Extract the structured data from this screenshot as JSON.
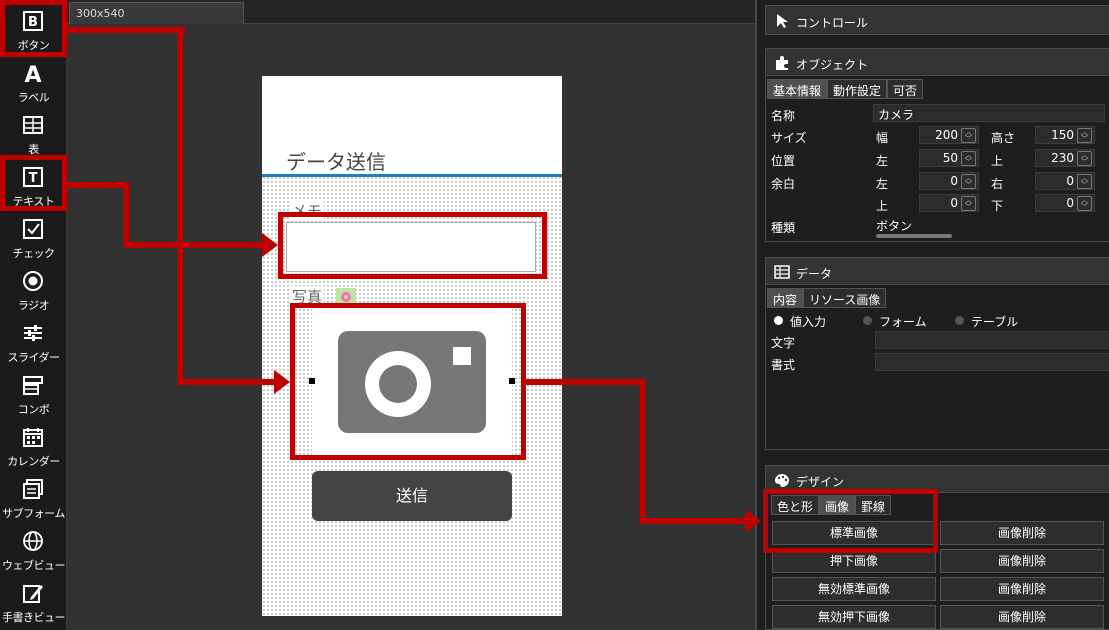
{
  "toolbox": {
    "items": [
      {
        "label": "ボタン",
        "icon": "button-icon"
      },
      {
        "label": "ラベル",
        "icon": "label-icon"
      },
      {
        "label": "表",
        "icon": "table-icon"
      },
      {
        "label": "テキスト",
        "icon": "text-icon"
      },
      {
        "label": "チェック",
        "icon": "checkbox-icon"
      },
      {
        "label": "ラジオ",
        "icon": "radio-icon"
      },
      {
        "label": "スライダー",
        "icon": "slider-icon"
      },
      {
        "label": "コンボ",
        "icon": "combo-icon"
      },
      {
        "label": "カレンダー",
        "icon": "calendar-icon"
      },
      {
        "label": "サブフォーム",
        "icon": "subform-icon"
      },
      {
        "label": "ウェブビュー",
        "icon": "webview-icon"
      },
      {
        "label": "手書きビュー",
        "icon": "handwriting-icon"
      }
    ]
  },
  "canvas": {
    "tab_label": "300x540",
    "form_title": "データ送信",
    "memo_label": "メモ",
    "photo_label": "写真",
    "send_button": "送信"
  },
  "properties": {
    "control": {
      "title": "コントロール"
    },
    "object": {
      "title": "オブジェクト",
      "tabs": [
        "基本情報",
        "動作設定",
        "可否"
      ],
      "name_label": "名称",
      "name_value": "カメラ",
      "size_label": "サイズ",
      "width_label": "幅",
      "width_value": "200",
      "height_label": "高さ",
      "height_value": "150",
      "position_label": "位置",
      "left_label": "左",
      "left_value": "50",
      "top_label": "上",
      "top_value": "230",
      "margin_label": "余白",
      "margin_left_label": "左",
      "margin_left_value": "0",
      "margin_right_label": "右",
      "margin_right_value": "0",
      "margin_top_label": "上",
      "margin_top_value": "0",
      "margin_bottom_label": "下",
      "margin_bottom_value": "0",
      "kind_label": "種類",
      "kind_value": "ボタン"
    },
    "data": {
      "title": "データ",
      "tabs": [
        "内容",
        "リソース画像"
      ],
      "radios": [
        "値入力",
        "フォーム",
        "テーブル"
      ],
      "text_label": "文字",
      "format_label": "書式"
    },
    "design": {
      "title": "デザイン",
      "tabs": [
        "色と形",
        "画像",
        "罫線"
      ],
      "buttons": [
        [
          "標準画像",
          "画像削除"
        ],
        [
          "押下画像",
          "画像削除"
        ],
        [
          "無効標準画像",
          "画像削除"
        ],
        [
          "無効押下画像",
          "画像削除"
        ]
      ]
    }
  },
  "colors": {
    "annotation_red": "#c00000",
    "title_underline": "#1e7cc0"
  }
}
